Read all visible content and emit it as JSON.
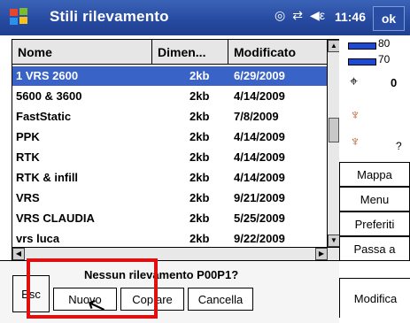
{
  "titlebar": {
    "title": "Stili rilevamento",
    "time": "11:46",
    "ok_label": "ok",
    "status_icons": [
      "gps-icon",
      "connectivity-icon",
      "volume-icon"
    ]
  },
  "table": {
    "columns": [
      "Nome",
      "Dimen...",
      "Modificato"
    ],
    "rows": [
      {
        "name": "1 VRS 2600",
        "size": "2kb",
        "modified": "6/29/2009",
        "selected": true
      },
      {
        "name": "5600 & 3600",
        "size": "2kb",
        "modified": "4/14/2009"
      },
      {
        "name": "FastStatic",
        "size": "2kb",
        "modified": "7/8/2009"
      },
      {
        "name": "PPK",
        "size": "2kb",
        "modified": "4/14/2009"
      },
      {
        "name": "RTK",
        "size": "2kb",
        "modified": "4/14/2009"
      },
      {
        "name": "RTK & infill",
        "size": "2kb",
        "modified": "4/14/2009"
      },
      {
        "name": "VRS",
        "size": "2kb",
        "modified": "9/21/2009"
      },
      {
        "name": "VRS CLAUDIA",
        "size": "2kb",
        "modified": "5/25/2009"
      },
      {
        "name": "vrs luca",
        "size": "2kb",
        "modified": "9/22/2009"
      }
    ]
  },
  "sidebar": {
    "battery1_label": "80",
    "battery2_label": "70",
    "satellite_count": "0",
    "question_mark": "?",
    "buttons": [
      "Mappa",
      "Menu",
      "Preferiti",
      "Passa a"
    ]
  },
  "bottom": {
    "esc_label": "Esc",
    "message": "Nessun rilevamento  P00P1?",
    "new_label": "Nuovo",
    "copy_label": "Copiare",
    "delete_label": "Cancella",
    "modify_label": "Modifica"
  },
  "colors": {
    "titlebar": "#2649a0",
    "selected_row": "#3a63c8",
    "highlight": "#e01010"
  }
}
